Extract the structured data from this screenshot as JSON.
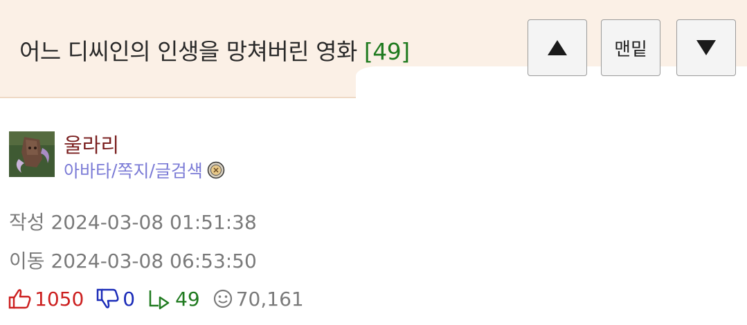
{
  "post": {
    "title": "어느 디씨인의 인생을 망쳐버린 영화",
    "comment_count": "[49]"
  },
  "nav": {
    "up_icon": "triangle-up-icon",
    "bottom_label": "맨밑",
    "down_icon": "triangle-down-icon"
  },
  "author": {
    "name": "울라리",
    "links": [
      "아바타",
      "쪽지",
      "글검색"
    ],
    "separator": "/",
    "badge_icon": "level-badge-icon"
  },
  "meta": {
    "created_label": "작성",
    "created": "2024-03-08 01:51:38",
    "moved_label": "이동",
    "moved": "2024-03-08 06:53:50"
  },
  "stats": {
    "likes": "1050",
    "dislikes": "0",
    "replies": "49",
    "views": "70,161"
  },
  "colors": {
    "header_bg": "#fbf0e6",
    "like": "#cc1f1f",
    "dislike": "#1a2bb8",
    "reply": "#1f7a1f",
    "link": "#7b7bd6",
    "author": "#7a1f1f"
  }
}
